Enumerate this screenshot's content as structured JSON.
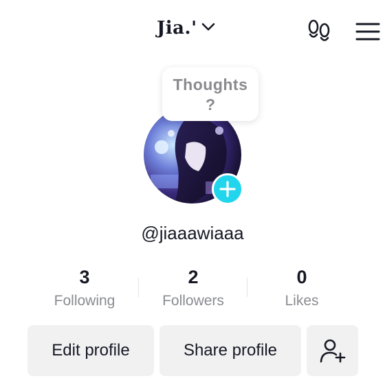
{
  "header": {
    "username_title": "Jia.'",
    "chevron_icon": "chevron-down-icon",
    "footprint_icon": "footprint-icon",
    "menu_icon": "hamburger-menu-icon"
  },
  "note_bubble": {
    "line1": "Thoughts",
    "line2": "?"
  },
  "profile": {
    "avatar_icon": "avatar",
    "add_icon": "plus-icon",
    "handle": "@jiaaawiaaa"
  },
  "stats": [
    {
      "value": "3",
      "label": "Following"
    },
    {
      "value": "2",
      "label": "Followers"
    },
    {
      "value": "0",
      "label": "Likes"
    }
  ],
  "actions": {
    "edit_label": "Edit profile",
    "share_label": "Share profile",
    "add_friends_icon": "add-user-icon"
  },
  "colors": {
    "accent": "#20d5ec",
    "text": "#161823",
    "muted": "#8a8b91",
    "button_bg": "#f1f1f2"
  }
}
